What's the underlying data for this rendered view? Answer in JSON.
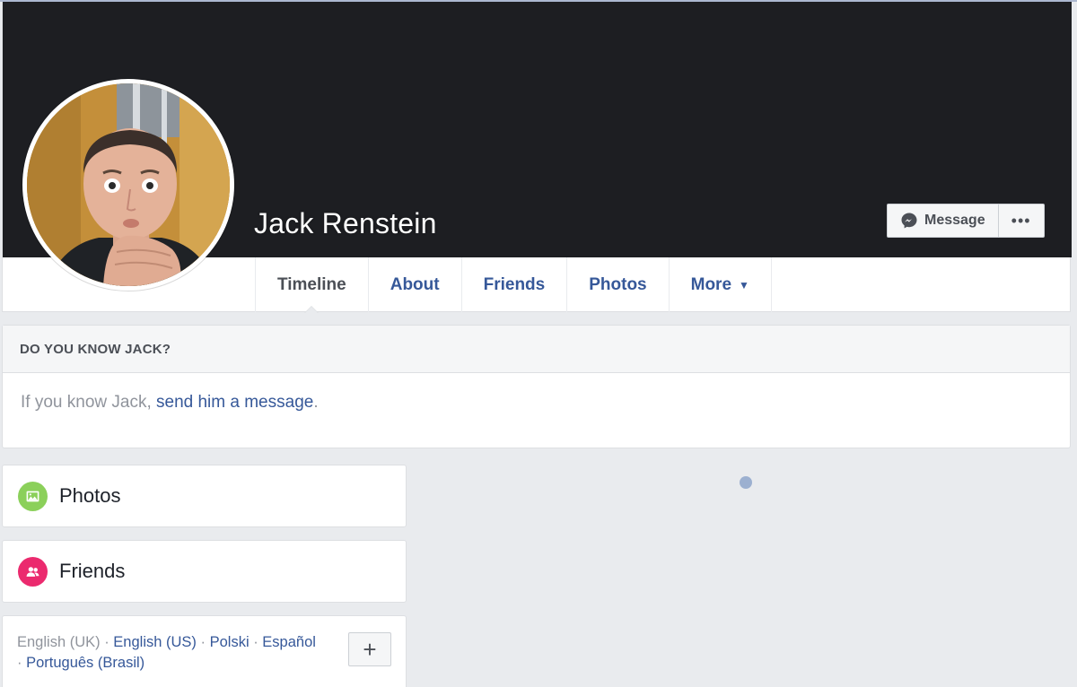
{
  "profile": {
    "name": "Jack Renstein",
    "photo_icon": "profile-photo"
  },
  "actions": {
    "message_label": "Message",
    "more_label": "•••"
  },
  "tabs": [
    {
      "label": "Timeline",
      "active": true
    },
    {
      "label": "About"
    },
    {
      "label": "Friends"
    },
    {
      "label": "Photos"
    },
    {
      "label": "More"
    }
  ],
  "know_card": {
    "heading": "DO YOU KNOW JACK?",
    "prefix": "If you know Jack, ",
    "link": "send him a message",
    "suffix": "."
  },
  "sidebar": {
    "photos_label": "Photos",
    "friends_label": "Friends"
  },
  "languages": {
    "current": "English (UK)",
    "sep": " · ",
    "links": [
      "English (US)",
      "Polski",
      "Español",
      "Português (Brasil)"
    ],
    "add_label": "+"
  },
  "colors": {
    "cover": "#1d1e22",
    "link": "#365899",
    "photos_icon_bg": "#8bd05a",
    "friends_icon_bg": "#eb2a6e"
  }
}
